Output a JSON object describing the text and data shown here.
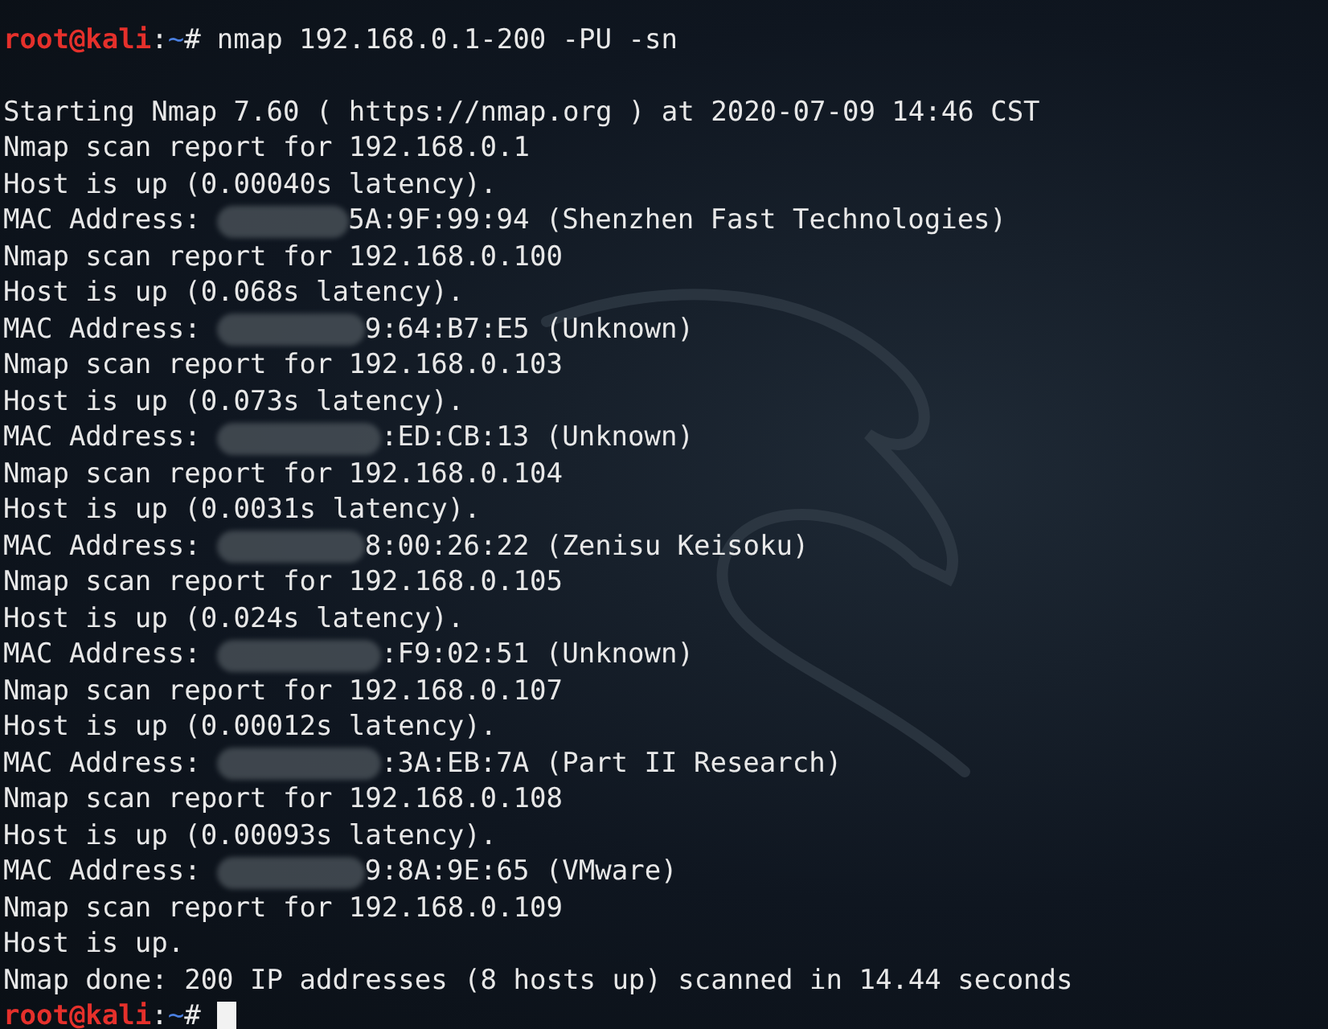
{
  "lines": [
    {
      "kind": "prompt",
      "user": "root@kali",
      "separator": ":",
      "path": "~",
      "symbol": "#",
      "command": "nmap 192.168.0.1-200 -PU -sn",
      "cursor": false
    },
    {
      "kind": "blank"
    },
    {
      "kind": "text",
      "text": "Starting Nmap 7.60 ( https://nmap.org ) at 2020-07-09 14:46 CST"
    },
    {
      "kind": "text",
      "text": "Nmap scan report for 192.168.0.1"
    },
    {
      "kind": "text",
      "text": "Host is up (0.00040s latency)."
    },
    {
      "kind": "mac",
      "label": "MAC Address:",
      "tail": "5A:9F:99:94 (Shenzhen Fast Technologies)"
    },
    {
      "kind": "text",
      "text": "Nmap scan report for 192.168.0.100"
    },
    {
      "kind": "text",
      "text": "Host is up (0.068s latency)."
    },
    {
      "kind": "mac",
      "label": "MAC Address:",
      "tail": "9:64:B7:E5 (Unknown)"
    },
    {
      "kind": "text",
      "text": "Nmap scan report for 192.168.0.103"
    },
    {
      "kind": "text",
      "text": "Host is up (0.073s latency)."
    },
    {
      "kind": "mac",
      "label": "MAC Address:",
      "tail": ":ED:CB:13 (Unknown)"
    },
    {
      "kind": "text",
      "text": "Nmap scan report for 192.168.0.104"
    },
    {
      "kind": "text",
      "text": "Host is up (0.0031s latency)."
    },
    {
      "kind": "mac",
      "label": "MAC Address:",
      "tail": "8:00:26:22 (Zenisu Keisoku)"
    },
    {
      "kind": "text",
      "text": "Nmap scan report for 192.168.0.105"
    },
    {
      "kind": "text",
      "text": "Host is up (0.024s latency)."
    },
    {
      "kind": "mac",
      "label": "MAC Address:",
      "tail": ":F9:02:51 (Unknown)"
    },
    {
      "kind": "text",
      "text": "Nmap scan report for 192.168.0.107"
    },
    {
      "kind": "text",
      "text": "Host is up (0.00012s latency)."
    },
    {
      "kind": "mac",
      "label": "MAC Address:",
      "tail": ":3A:EB:7A (Part II Research)"
    },
    {
      "kind": "text",
      "text": "Nmap scan report for 192.168.0.108"
    },
    {
      "kind": "text",
      "text": "Host is up (0.00093s latency)."
    },
    {
      "kind": "mac",
      "label": "MAC Address:",
      "tail": "9:8A:9E:65 (VMware)"
    },
    {
      "kind": "text",
      "text": "Nmap scan report for 192.168.0.109"
    },
    {
      "kind": "text",
      "text": "Host is up."
    },
    {
      "kind": "text",
      "text": "Nmap done: 200 IP addresses (8 hosts up) scanned in 14.44 seconds"
    },
    {
      "kind": "prompt",
      "user": "root@kali",
      "separator": ":",
      "path": "~",
      "symbol": "#",
      "cursor": true
    }
  ]
}
